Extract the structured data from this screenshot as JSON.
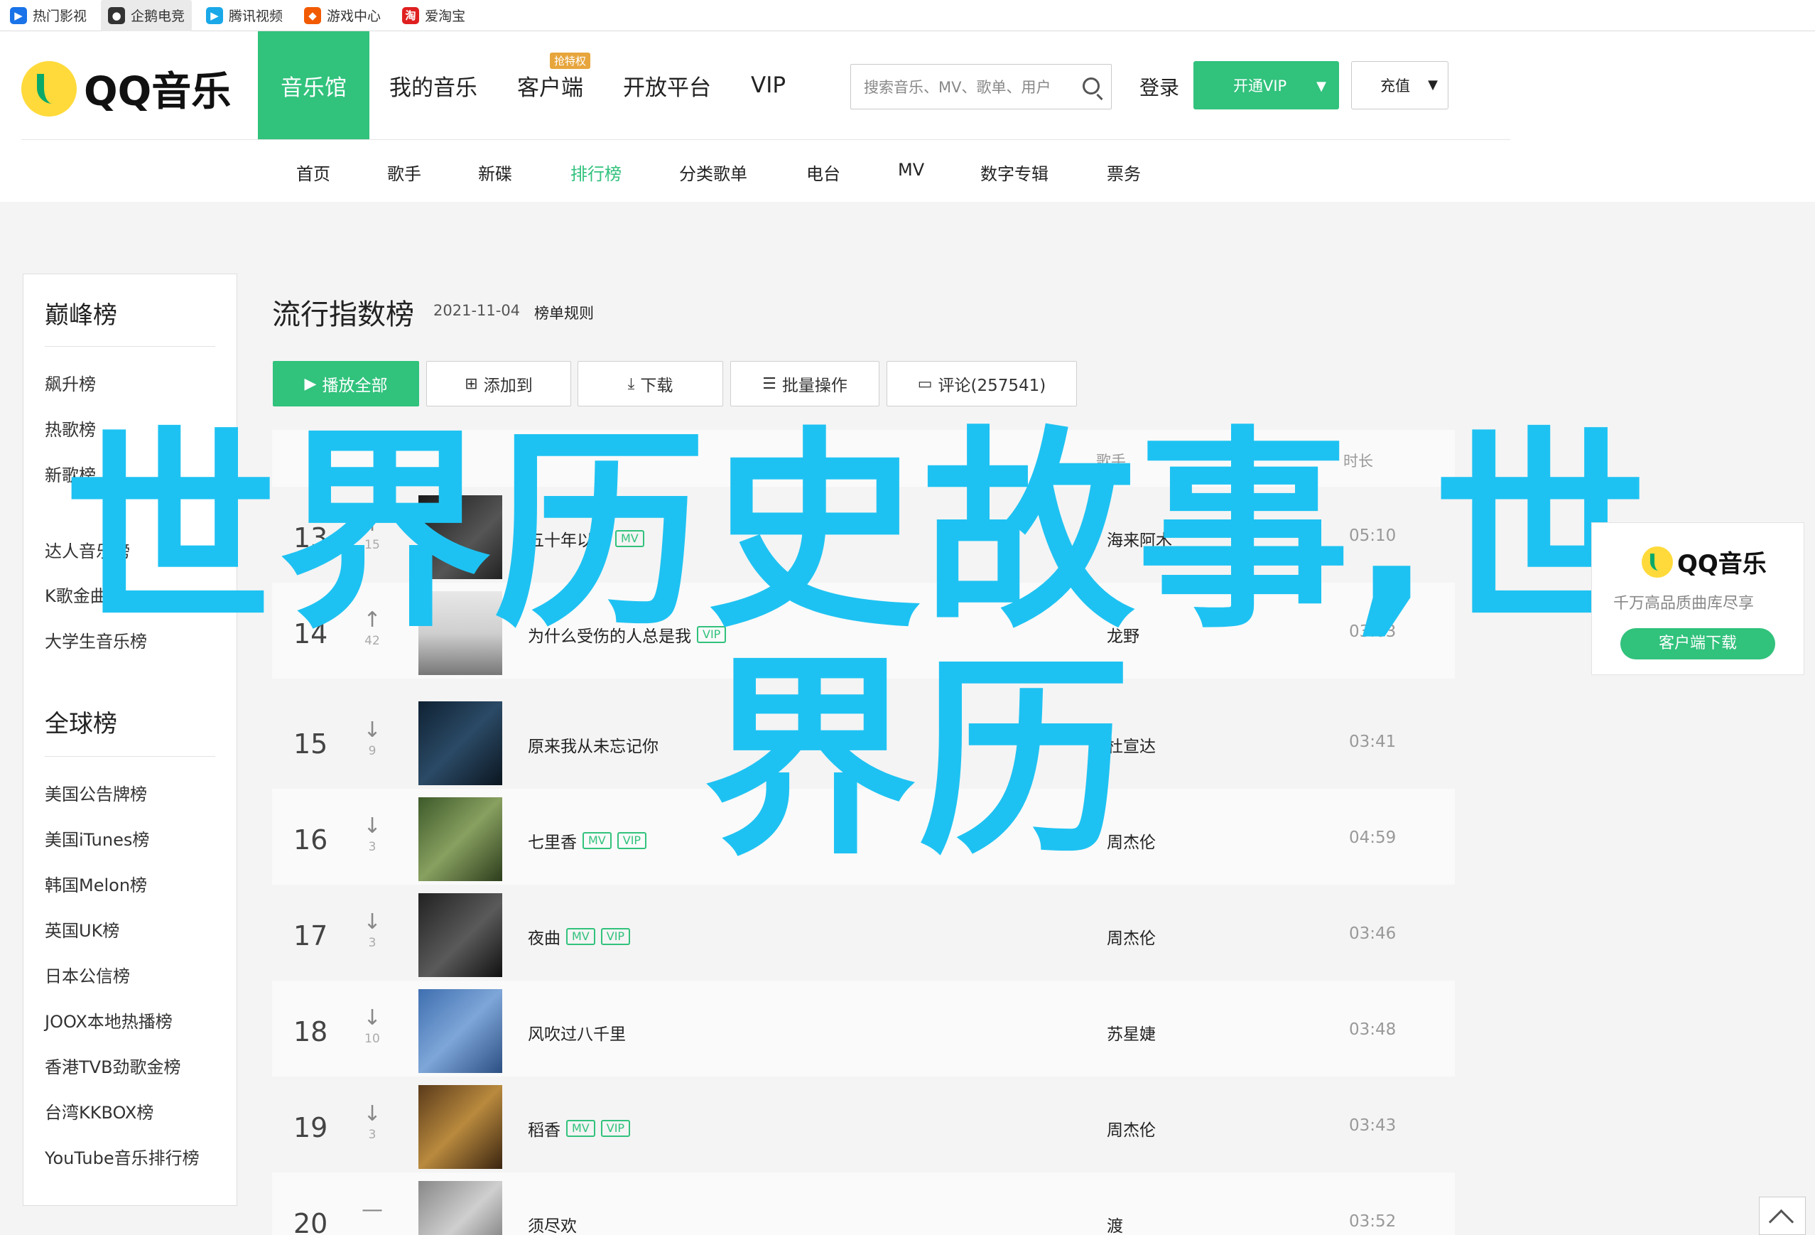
{
  "bookmarks": [
    {
      "label": "热门影视",
      "icon": "video-icon",
      "color": "#1a73e8"
    },
    {
      "label": "企鹅电竞",
      "icon": "penguin-icon",
      "color": "#333333"
    },
    {
      "label": "腾讯视频",
      "icon": "play-icon",
      "color": "#ff7a00"
    },
    {
      "label": "游戏中心",
      "icon": "gamepad-icon",
      "color": "#f25a00"
    },
    {
      "label": "爱淘宝",
      "icon": "taobao-icon",
      "color": "#e02020"
    }
  ],
  "header": {
    "logo_text": "QQ音乐",
    "nav": [
      "音乐馆",
      "我的音乐",
      "客户端",
      "开放平台",
      "VIP"
    ],
    "nav_badge": "抢特权",
    "search_placeholder": "搜索音乐、MV、歌单、用户",
    "login": "登录",
    "vip_button": "开通VIP",
    "charge_button": "充值",
    "subnav": [
      "首页",
      "歌手",
      "新碟",
      "排行榜",
      "分类歌单",
      "电台",
      "MV",
      "数字专辑",
      "票务"
    ],
    "subnav_active": "排行榜"
  },
  "sidebar": {
    "peak_title": "巅峰榜",
    "peak_items": [
      "飙升榜",
      "热歌榜",
      "新歌榜",
      "",
      "达人音乐榜",
      "K歌金曲榜",
      "大学生音乐榜"
    ],
    "global_title": "全球榜",
    "global_items": [
      "美国公告牌榜",
      "美国iTunes榜",
      "韩国Melon榜",
      "英国UK榜",
      "日本公信榜",
      "JOOX本地热播榜",
      "香港TVB劲歌金榜",
      "台湾KKBOX榜",
      "YouTube音乐排行榜"
    ]
  },
  "content": {
    "title": "流行指数榜",
    "date": "2021-11-04",
    "rule_link": "榜单规则",
    "buttons": {
      "play_all": "播放全部",
      "add_to": "添加到",
      "download": "下载",
      "batch": "批量操作",
      "comments": "评论(257541)"
    },
    "table_headers": {
      "singer": "歌手",
      "duration": "时长"
    },
    "rows": [
      {
        "rank": "13",
        "trend": "↑",
        "change": "15",
        "title": "五十年以后",
        "tags": [
          "MV"
        ],
        "singer": "海来阿木",
        "duration": "05:10"
      },
      {
        "rank": "14",
        "trend": "↑",
        "change": "42",
        "title": "为什么受伤的人总是我",
        "tags": [
          "VIP"
        ],
        "singer": "龙野",
        "duration": "03:03"
      },
      {
        "rank": "15",
        "trend": "↓",
        "change": "9",
        "title": "原来我从未忘记你",
        "tags": [],
        "singer": "杜宣达",
        "duration": "03:41"
      },
      {
        "rank": "16",
        "trend": "↓",
        "change": "3",
        "title": "七里香",
        "tags": [
          "MV",
          "VIP"
        ],
        "singer": "周杰伦",
        "duration": "04:59"
      },
      {
        "rank": "17",
        "trend": "↓",
        "change": "3",
        "title": "夜曲",
        "tags": [
          "MV",
          "VIP"
        ],
        "singer": "周杰伦",
        "duration": "03:46"
      },
      {
        "rank": "18",
        "trend": "↓",
        "change": "10",
        "title": "风吹过八千里",
        "tags": [],
        "singer": "苏星婕",
        "duration": "03:48"
      },
      {
        "rank": "19",
        "trend": "↓",
        "change": "3",
        "title": "稻香",
        "tags": [
          "MV",
          "VIP"
        ],
        "singer": "周杰伦",
        "duration": "03:43"
      },
      {
        "rank": "20",
        "trend": "—",
        "change": "",
        "title": "须尽欢",
        "tags": [],
        "singer": "渡",
        "duration": "03:52"
      }
    ]
  },
  "ad": {
    "logo_text": "QQ音乐",
    "subtitle": "千万高品质曲库尽享",
    "button": "客户端下载"
  },
  "overlay": {
    "line1": "世界历史故事,世",
    "line2": "界历"
  },
  "colors": {
    "brand_green": "#31c27c",
    "overlay_blue": "#1ec2f2"
  }
}
